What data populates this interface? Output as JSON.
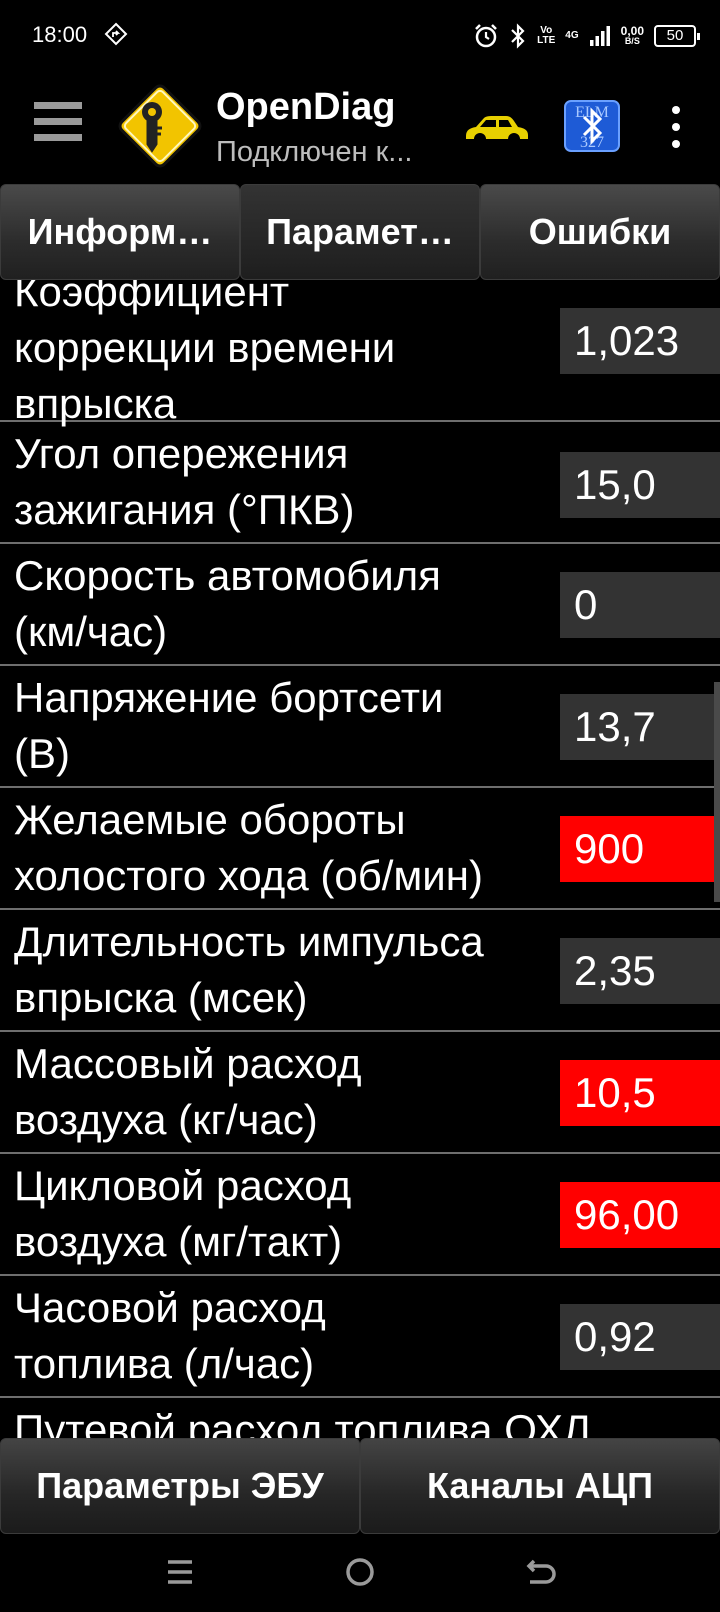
{
  "status": {
    "time": "18:00",
    "net_top": "Vo",
    "net_bottom": "LTE",
    "signal": "4G",
    "speed_top": "0,00",
    "speed_bottom": "B/S",
    "battery": "50"
  },
  "app": {
    "title": "OpenDiag",
    "subtitle": "Подключен к...",
    "bt_badge_top": "ELM",
    "bt_badge_bottom": "327"
  },
  "tabs": [
    {
      "label": "Информ…"
    },
    {
      "label": "Парамет…"
    },
    {
      "label": "Ошибки"
    }
  ],
  "params": [
    {
      "label": "Коэффициент\nкоррекции времени\nвпрыска",
      "value": "1,023",
      "alert": false
    },
    {
      "label": "Угол опережения\nзажигания (°ПКВ)",
      "value": "15,0",
      "alert": false
    },
    {
      "label": "Скорость автомобиля\n(км/час)",
      "value": "0",
      "alert": false
    },
    {
      "label": "Напряжение бортсети\n(В)",
      "value": "13,7",
      "alert": false
    },
    {
      "label": "Желаемые обороты\nхолостого хода (об/мин)",
      "value": "900",
      "alert": true
    },
    {
      "label": "Длительность импульса\nвпрыска (мсек)",
      "value": "2,35",
      "alert": false
    },
    {
      "label": "Массовый расход\nвоздуха (кг/час)",
      "value": "10,5",
      "alert": true
    },
    {
      "label": "Цикловой расход\nвоздуха (мг/такт)",
      "value": "96,00",
      "alert": true
    },
    {
      "label": "Часовой расход\nтоплива (л/час)",
      "value": "0,92",
      "alert": false
    },
    {
      "label": "Путевой расход топлива ОХЛ",
      "value": "",
      "alert": false
    }
  ],
  "bottom_buttons": [
    {
      "label": "Параметры ЭБУ"
    },
    {
      "label": "Каналы АЦП"
    }
  ],
  "colors": {
    "alert": "#ff0000",
    "value_bg": "#333333",
    "logo_yellow": "#f2c400",
    "car_yellow": "#e8d000",
    "bt_blue": "#1e5bd6"
  },
  "icons": [
    "menu-icon",
    "app-logo-key-icon",
    "car-icon",
    "bluetooth-elm-icon",
    "more-options-icon",
    "nav-recents-icon",
    "nav-home-icon",
    "nav-back-icon"
  ]
}
